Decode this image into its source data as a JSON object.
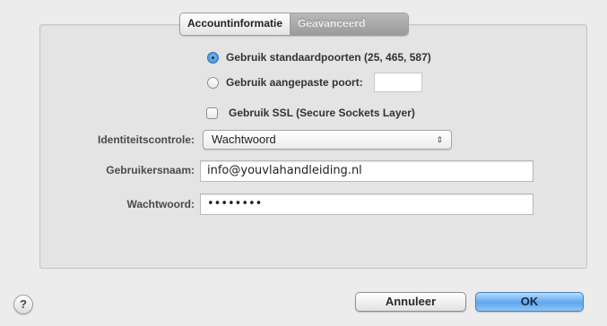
{
  "tabs": [
    {
      "label": "Accountinformatie",
      "active": false
    },
    {
      "label": "Geavanceerd",
      "active": true
    }
  ],
  "ports": {
    "default_label": "Gebruik standaardpoorten (25, 465, 587)",
    "custom_label": "Gebruik aangepaste poort:",
    "custom_value": "",
    "selected": "default"
  },
  "ssl": {
    "label": "Gebruik SSL (Secure Sockets Layer)",
    "checked": false
  },
  "auth": {
    "label": "Identiteitscontrole:",
    "value": "Wachtwoord"
  },
  "username": {
    "label": "Gebruikersnaam:",
    "value": "info@youvlahandleiding.nl"
  },
  "password": {
    "label": "Wachtwoord:",
    "value": "••••••••"
  },
  "buttons": {
    "help": "?",
    "cancel": "Annuleer",
    "ok": "OK"
  },
  "colors": {
    "accent": "#5fa7ec",
    "window_bg": "#ececec"
  }
}
